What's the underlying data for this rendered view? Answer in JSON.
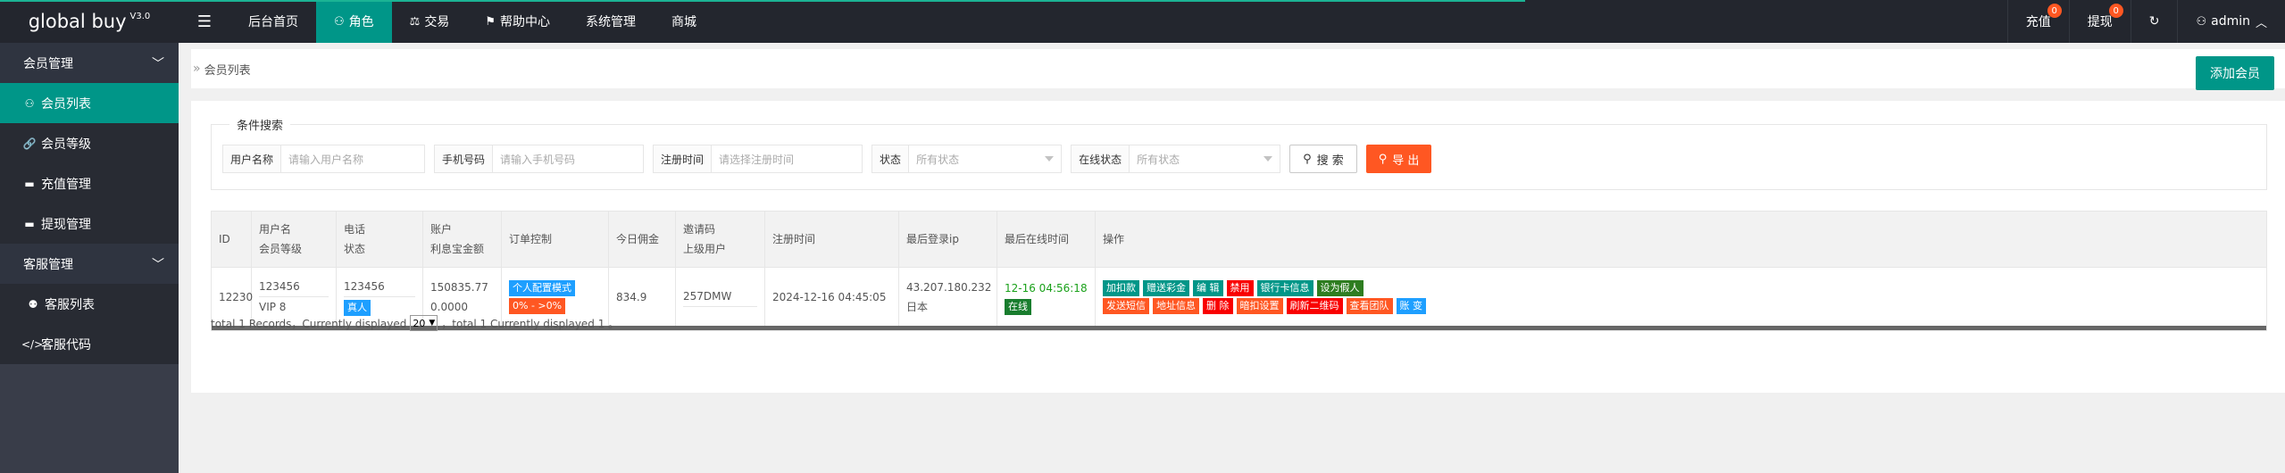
{
  "app": {
    "logo": "global buy",
    "version": "V3.0"
  },
  "topnav": {
    "items": [
      {
        "label": "后台首页",
        "icon": ""
      },
      {
        "label": "角色",
        "icon": "user-icon"
      },
      {
        "label": "交易",
        "icon": "scale-icon"
      },
      {
        "label": "帮助中心",
        "icon": "flag-icon"
      },
      {
        "label": "系统管理",
        "icon": ""
      },
      {
        "label": "商城",
        "icon": ""
      }
    ],
    "right": {
      "recharge": "充值",
      "recharge_badge": "0",
      "withdraw": "提现",
      "withdraw_badge": "0",
      "user": "admin"
    }
  },
  "sidebar": {
    "groups": [
      {
        "label": "会员管理"
      },
      {
        "label": "客服管理"
      }
    ],
    "items": [
      {
        "label": "会员列表"
      },
      {
        "label": "会员等级"
      },
      {
        "label": "充值管理"
      },
      {
        "label": "提现管理"
      },
      {
        "label": "客服列表"
      },
      {
        "label": "客服代码"
      }
    ]
  },
  "breadcrumb": {
    "current": "会员列表",
    "add_button": "添加会员"
  },
  "search": {
    "legend": "条件搜索",
    "fields": [
      {
        "label": "用户名称",
        "placeholder": "请输入用户名称"
      },
      {
        "label": "手机号码",
        "placeholder": "请输入手机号码"
      },
      {
        "label": "注册时间",
        "placeholder": "请选择注册时间"
      },
      {
        "label": "状态",
        "placeholder": "所有状态"
      },
      {
        "label": "在线状态",
        "placeholder": "所有状态"
      }
    ],
    "search_button": "搜 索",
    "export_button": "导 出"
  },
  "table": {
    "headers": {
      "id": "ID",
      "username": "用户名",
      "level": "会员等级",
      "phone": "电话",
      "status": "状态",
      "account": "账户",
      "interest": "利息宝金额",
      "order_control": "订单控制",
      "commission": "今日佣金",
      "invite": "邀请码",
      "parent": "上级用户",
      "reg_time": "注册时间",
      "last_ip": "最后登录ip",
      "last_online": "最后在线时间",
      "ops": "操作"
    },
    "row": {
      "id": "12230",
      "username": "123456",
      "level": "VIP 8",
      "phone": "123456",
      "status": "真人",
      "account": "150835.77",
      "interest": "0.0000",
      "order_mode": "个人配置模式",
      "order_range": "0% - >0%",
      "commission": "834.9",
      "invite": "257DMW",
      "parent": "",
      "reg_time": "2024-12-16 04:45:05",
      "ip": "43.207.180.232",
      "ip_region": "日本",
      "online_time": "12-16 04:56:18",
      "online_status": "在线",
      "ops_row1": [
        "加扣款",
        "赠送彩金",
        "编 辑",
        "禁用",
        "银行卡信息",
        "设为假人"
      ],
      "ops_row2": [
        "发送短信",
        "地址信息",
        "删 除",
        "暗扣设置",
        "刷新二维码",
        "查看团队",
        "账 变"
      ]
    }
  },
  "footer": {
    "prefix": "total 1 Records，Currently displayed",
    "page_size": "20",
    "suffix": "，total 1 Currently displayed 1 。"
  },
  "colors": {
    "accent": "#009688",
    "topbar": "#23262e",
    "sidebar": "#393d49",
    "danger": "#ff5722"
  }
}
